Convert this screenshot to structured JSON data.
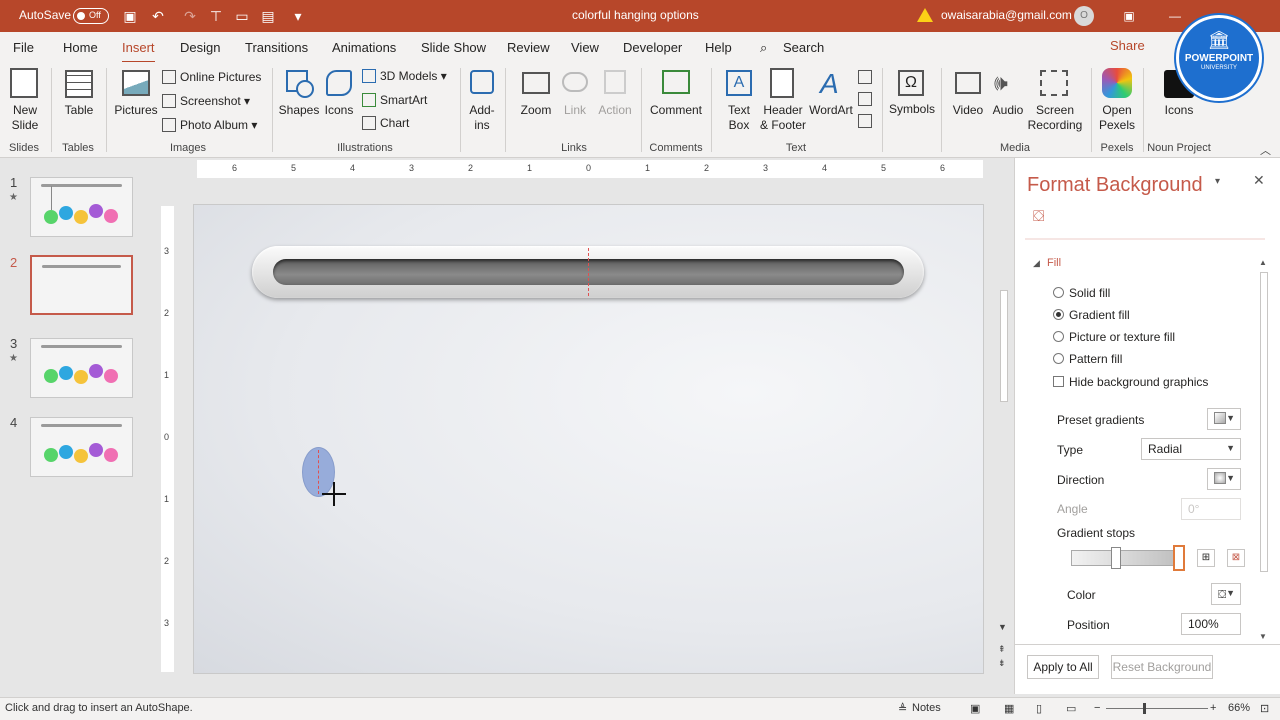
{
  "titlebar": {
    "autosave_label": "AutoSave",
    "autosave_state": "Off",
    "doc_title": "colorful hanging options",
    "account": "owaisarabia@gmail.com",
    "accent": "#b7472a"
  },
  "tabs": [
    "File",
    "Home",
    "Insert",
    "Design",
    "Transitions",
    "Animations",
    "Slide Show",
    "Review",
    "View",
    "Developer",
    "Help"
  ],
  "active_tab": "Insert",
  "search_label": "Search",
  "share_label": "Share",
  "ribbon": {
    "new_slide": "New Slide",
    "table": "Table",
    "pictures": "Pictures",
    "online_pictures": "Online Pictures",
    "screenshot": "Screenshot",
    "photo_album": "Photo Album",
    "shapes": "Shapes",
    "icons": "Icons",
    "models3d": "3D Models",
    "smartart": "SmartArt",
    "chart": "Chart",
    "addins": "Add-ins",
    "zoom": "Zoom",
    "link": "Link",
    "action": "Action",
    "comment": "Comment",
    "text_box": "Text Box",
    "header_footer": "Header & Footer",
    "wordart": "WordArt",
    "symbols": "Symbols",
    "video": "Video",
    "audio": "Audio",
    "screen_recording": "Screen Recording",
    "open_pexels": "Open Pexels",
    "np_icons": "Icons",
    "groups": {
      "slides": "Slides",
      "tables": "Tables",
      "images": "Images",
      "illustrations": "Illustrations",
      "links": "Links",
      "comments": "Comments",
      "text": "Text",
      "media": "Media",
      "pexels": "Pexels",
      "noun_project": "Noun Project"
    }
  },
  "badge": {
    "top": "POWERPOINT",
    "bottom": "UNIVERSITY"
  },
  "slides": [
    {
      "number": "1",
      "star": "★"
    },
    {
      "number": "2",
      "star": ""
    },
    {
      "number": "3",
      "star": "★"
    },
    {
      "number": "4",
      "star": ""
    }
  ],
  "ruler_h": [
    "6",
    "5",
    "4",
    "3",
    "2",
    "1",
    "0",
    "1",
    "2",
    "3",
    "4",
    "5",
    "6"
  ],
  "ruler_v": [
    "3",
    "2",
    "1",
    "0",
    "1",
    "2",
    "3"
  ],
  "format_pane": {
    "title": "Format Background",
    "section": "Fill",
    "options": [
      "Solid fill",
      "Gradient fill",
      "Picture or texture fill",
      "Pattern fill"
    ],
    "selected_option": "Gradient fill",
    "hide_bg": "Hide background graphics",
    "preset_gradients": "Preset gradients",
    "type_label": "Type",
    "type_value": "Radial",
    "direction_label": "Direction",
    "angle_label": "Angle",
    "angle_value": "0°",
    "gradient_stops": "Gradient stops",
    "color_label": "Color",
    "position_label": "Position",
    "position_value": "100%",
    "apply_all": "Apply to All",
    "reset": "Reset Background"
  },
  "status": {
    "message": "Click and drag to insert an AutoShape.",
    "notes": "Notes",
    "zoom": "66%"
  }
}
